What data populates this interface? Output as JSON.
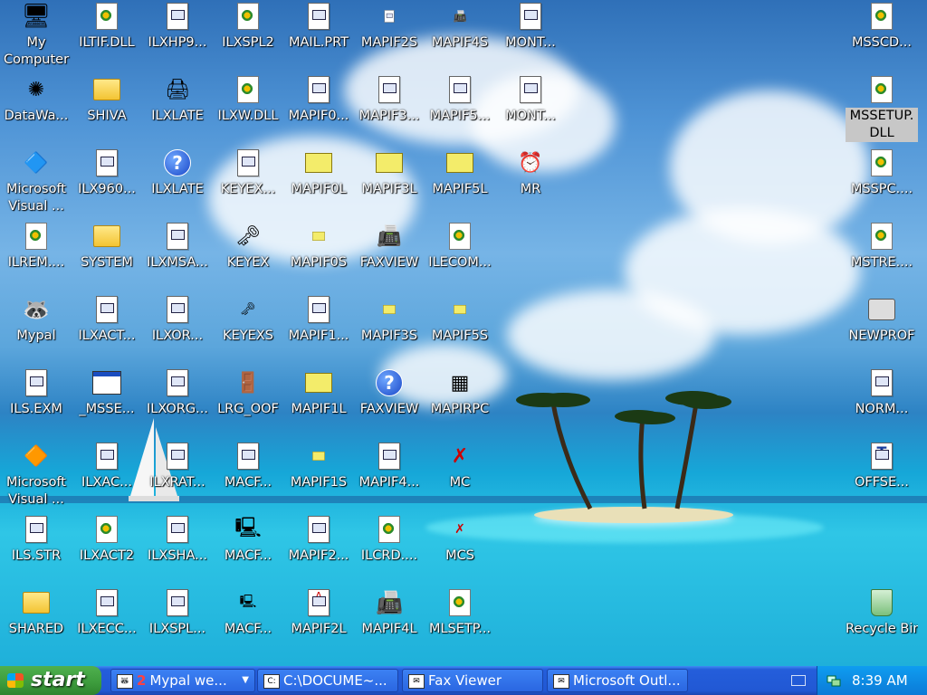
{
  "desktop": {
    "icons": [
      {
        "label": "My Computer",
        "glyph": "computer-icon"
      },
      {
        "label": "ILTIF.DLL",
        "glyph": "gear-doc-icon"
      },
      {
        "label": "ILXHP9...",
        "glyph": "doc-icon"
      },
      {
        "label": "ILXSPL2",
        "glyph": "gear-doc-icon"
      },
      {
        "label": "MAIL.PRT",
        "glyph": "doc-icon"
      },
      {
        "label": "MAPIF2S",
        "glyph": "doc-small-icon"
      },
      {
        "label": "MAPIF4S",
        "glyph": "fax-small-icon"
      },
      {
        "label": "MONT...",
        "glyph": "doc-icon"
      },
      {
        "label": "MSSCD...",
        "glyph": "gear-doc-icon"
      },
      {
        "label": "DataWa...",
        "glyph": "app-icon"
      },
      {
        "label": "SHIVA",
        "glyph": "folder-icon"
      },
      {
        "label": "ILXLATE",
        "glyph": "pc-app-icon"
      },
      {
        "label": "ILXW.DLL",
        "glyph": "gear-doc-icon"
      },
      {
        "label": "MAPIF0...",
        "glyph": "doc-icon"
      },
      {
        "label": "MAPIF3...",
        "glyph": "doc-icon"
      },
      {
        "label": "MAPIF5...",
        "glyph": "doc-icon"
      },
      {
        "label": "MONT...",
        "glyph": "doc-icon"
      },
      {
        "label": "MSSETUP. DLL",
        "glyph": "gear-doc-icon"
      },
      {
        "label": "Microsoft Visual ...",
        "glyph": "visual-icon"
      },
      {
        "label": "ILX960...",
        "glyph": "doc-icon"
      },
      {
        "label": "ILXLATE",
        "glyph": "help-icon"
      },
      {
        "label": "KEYEX...",
        "glyph": "doc-icon"
      },
      {
        "label": "MAPIF0L",
        "glyph": "envelope-icon"
      },
      {
        "label": "MAPIF3L",
        "glyph": "envelope-icon"
      },
      {
        "label": "MAPIF5L",
        "glyph": "envelope-icon"
      },
      {
        "label": "MR",
        "glyph": "clock-envelope-icon"
      },
      {
        "label": "MSSPC....",
        "glyph": "gear-doc-icon"
      },
      {
        "label": "ILREM....",
        "glyph": "gear-doc-icon"
      },
      {
        "label": "SYSTEM",
        "glyph": "folder-icon"
      },
      {
        "label": "ILXMSA...",
        "glyph": "doc-icon"
      },
      {
        "label": "KEYEX",
        "glyph": "key-icon"
      },
      {
        "label": "MAPIF0S",
        "glyph": "envelope-small-icon"
      },
      {
        "label": "FAXVIEW",
        "glyph": "fax-icon"
      },
      {
        "label": "ILECOM...",
        "glyph": "gear-doc-icon"
      },
      {
        "label": "MSTRE....",
        "glyph": "gear-doc-icon"
      },
      {
        "label": "Mypal",
        "glyph": "raccoon-icon"
      },
      {
        "label": "ILXACT...",
        "glyph": "doc-icon"
      },
      {
        "label": "ILXOR...",
        "glyph": "doc-icon"
      },
      {
        "label": "KEYEXS",
        "glyph": "key-small-icon"
      },
      {
        "label": "MAPIF1...",
        "glyph": "doc-icon"
      },
      {
        "label": "MAPIF3S",
        "glyph": "envelope-small-icon"
      },
      {
        "label": "MAPIF5S",
        "glyph": "envelope-small-icon"
      },
      {
        "label": "NEWPROF",
        "glyph": "book-icon"
      },
      {
        "label": "ILS.EXM",
        "glyph": "doc-icon"
      },
      {
        "label": "_MSSE...",
        "glyph": "window-icon"
      },
      {
        "label": "ILXORG...",
        "glyph": "doc-icon"
      },
      {
        "label": "LRG_OOF",
        "glyph": "door-icon"
      },
      {
        "label": "MAPIF1L",
        "glyph": "envelope-icon"
      },
      {
        "label": "FAXVIEW",
        "glyph": "help-icon"
      },
      {
        "label": "MAPIRPC",
        "glyph": "cubes-icon"
      },
      {
        "label": "NORM...",
        "glyph": "doc-icon"
      },
      {
        "label": "Microsoft Visual ...",
        "glyph": "visual32-icon"
      },
      {
        "label": "ILXAC...",
        "glyph": "doc-icon"
      },
      {
        "label": "ILXRAT...",
        "glyph": "doc-icon"
      },
      {
        "label": "MACF...",
        "glyph": "doc-icon"
      },
      {
        "label": "MAPIF1S",
        "glyph": "envelope-small-icon"
      },
      {
        "label": "MAPIF4...",
        "glyph": "doc-icon"
      },
      {
        "label": "MC",
        "glyph": "no-mail-icon"
      },
      {
        "label": "OFFSE...",
        "glyph": "font-doc-icon"
      },
      {
        "label": "ILS.STR",
        "glyph": "doc-icon"
      },
      {
        "label": "ILXACT2",
        "glyph": "gear-doc-icon"
      },
      {
        "label": "ILXSHA...",
        "glyph": "doc-icon"
      },
      {
        "label": "MACF...",
        "glyph": "mac-icon"
      },
      {
        "label": "MAPIF2...",
        "glyph": "doc-icon"
      },
      {
        "label": "ILCRD....",
        "glyph": "gear-doc-icon"
      },
      {
        "label": "MCS",
        "glyph": "no-mail-small-icon"
      },
      {
        "label": "SHARED",
        "glyph": "folder-icon"
      },
      {
        "label": "ILXECC...",
        "glyph": "doc-icon"
      },
      {
        "label": "ILXSPL...",
        "glyph": "doc-icon"
      },
      {
        "label": "MACF...",
        "glyph": "mac-small-icon"
      },
      {
        "label": "MAPIF2L",
        "glyph": "text-doc-icon"
      },
      {
        "label": "MAPIF4L",
        "glyph": "fax-large-icon"
      },
      {
        "label": "MLSETP...",
        "glyph": "gear-doc-icon"
      },
      {
        "label": "Recycle Bin",
        "glyph": "recycle-bin-icon"
      }
    ]
  },
  "taskbar": {
    "start_label": "start",
    "tasks": [
      {
        "badge": "2",
        "label": "Mypal we..."
      },
      {
        "label": "C:\\DOCUME~..."
      },
      {
        "label": "Fax Viewer"
      },
      {
        "label": "Microsoft Outl..."
      }
    ],
    "clock": "8:39 AM"
  }
}
